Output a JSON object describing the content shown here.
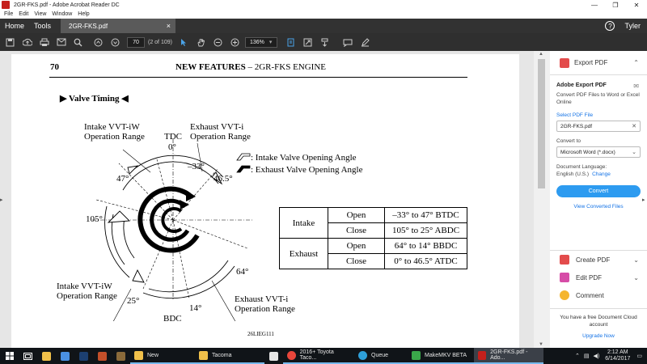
{
  "window": {
    "title": "2GR-FKS.pdf - Adobe Acrobat Reader DC",
    "minimize": "—",
    "maximize": "❐",
    "close": "✕"
  },
  "menu": [
    "File",
    "Edit",
    "View",
    "Window",
    "Help"
  ],
  "topnav": {
    "home": "Home",
    "tools": "Tools",
    "doc_tab": "2GR-FKS.pdf",
    "doc_tab_close": "×",
    "help": "?",
    "user": "Tyler"
  },
  "toolbar": {
    "page_value": "70",
    "page_label": "(2 of 109)",
    "zoom": "136%",
    "icons": [
      "save-icon",
      "upload-icon",
      "print-icon",
      "email-icon",
      "search-icon",
      "page-up-icon",
      "page-down-icon",
      "select-cursor-icon",
      "hand-icon",
      "zoom-out-icon",
      "zoom-in-icon",
      "fit-page-icon",
      "full-screen-icon",
      "scroll-mode-icon",
      "comment-icon",
      "sign-icon"
    ]
  },
  "document": {
    "page_number": "70",
    "header_bold": "NEW FEATURES",
    "header_rest": " – 2GR-FKS ENGINE",
    "section_title": "▶ Valve Timing ◀",
    "labels": {
      "intake_range_top": [
        "Intake VVT-iW",
        "Operation Range"
      ],
      "tdc": "TDC",
      "zero": "0°",
      "exhaust_range_top": [
        "Exhaust VVT-i",
        "Operation Range"
      ],
      "neg33": "–33°",
      "d465": "46.5°",
      "d47": "47°",
      "d105": "105°",
      "d64": "64°",
      "d25": "25°",
      "d14": "14°",
      "bdc": "BDC",
      "intake_range_bottom": [
        "Intake VVT-iW",
        "Operation Range"
      ],
      "exhaust_range_bottom": [
        "Exhaust VVT-i",
        "Operation Range"
      ],
      "legend_intake": ": Intake Valve Opening Angle",
      "legend_exhaust": ": Exhaust Valve Opening Angle"
    },
    "table": {
      "intake": "Intake",
      "exhaust": "Exhaust",
      "open": "Open",
      "close": "Close",
      "intake_open": "–33° to 47° BTDC",
      "intake_close": "105° to 25° ABDC",
      "exhaust_open": "64° to 14° BBDC",
      "exhaust_close": "0° to 46.5° ATDC"
    },
    "figure_code": "26LIEG111"
  },
  "right_panel": {
    "export_header": "Export PDF",
    "pane_title": "Adobe Export PDF",
    "pane_desc": "Convert PDF Files to Word or Excel Online",
    "select_file": "Select PDF File",
    "file_name": "2GR-FKS.pdf",
    "convert_to_label": "Convert to",
    "convert_to_value": "Microsoft Word (*.docx)",
    "doc_language_label": "Document Language:",
    "doc_language_value": "English (U.S.)",
    "change": "Change",
    "convert_button": "Convert",
    "view_converted": "View Converted Files",
    "tools": [
      "Create PDF",
      "Edit PDF",
      "Comment"
    ],
    "cloud_text": "You have a free Document Cloud account",
    "upgrade": "Upgrade Now"
  },
  "taskbar": {
    "apps": [
      "New",
      "Tacoma",
      "2016+ Toyota Taco...",
      "Queue",
      "MakeMKV BETA",
      "2GR-FKS.pdf - Ado..."
    ],
    "time": "2:12 AM",
    "date": "6/14/2017"
  }
}
